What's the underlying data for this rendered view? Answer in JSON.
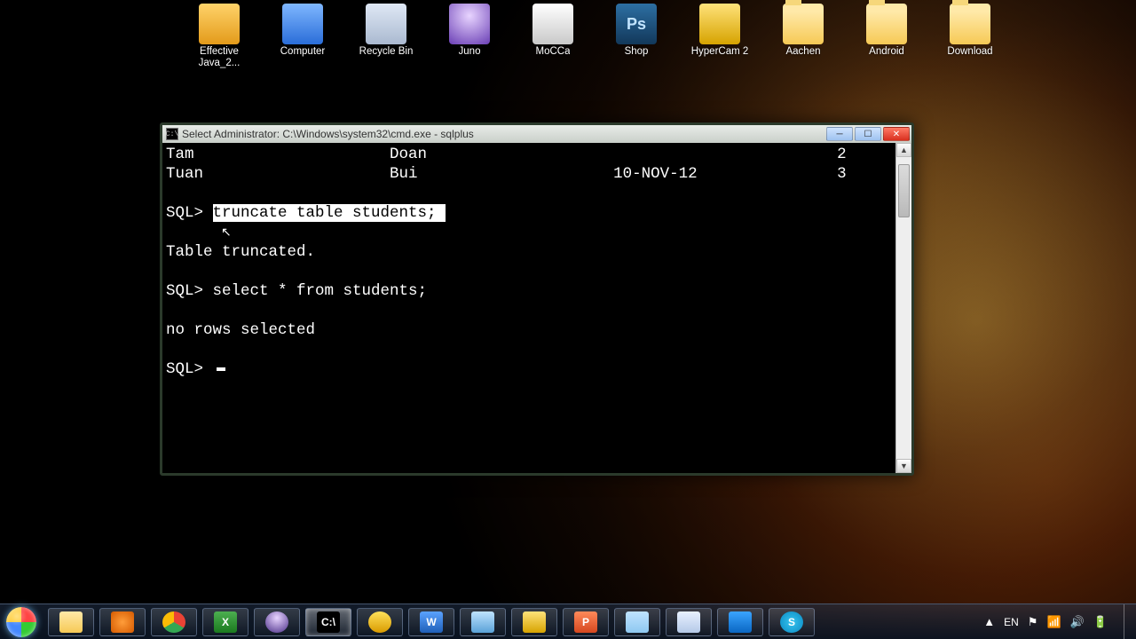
{
  "desktop_icons": [
    {
      "label": "Effective Java_2...",
      "kind": "pdf"
    },
    {
      "label": "Computer",
      "kind": "comp"
    },
    {
      "label": "Recycle Bin",
      "kind": "bin"
    },
    {
      "label": "Juno",
      "kind": "juno"
    },
    {
      "label": "MoCCa",
      "kind": "mocca"
    },
    {
      "label": "Shop",
      "kind": "ps",
      "text": "Ps"
    },
    {
      "label": "HyperCam 2",
      "kind": "hyper"
    },
    {
      "label": "Aachen",
      "kind": "folder"
    },
    {
      "label": "Android",
      "kind": "folder"
    },
    {
      "label": "Download",
      "kind": "folder"
    }
  ],
  "cmd": {
    "title": "Select Administrator: C:\\Windows\\system32\\cmd.exe - sqlplus",
    "sysicon": "C:\\",
    "rows": [
      {
        "c1": "Tam",
        "c2": "Doan",
        "c3": "",
        "c4": "2"
      },
      {
        "c1": "Tuan",
        "c2": "Bui",
        "c3": "10-NOV-12",
        "c4": "3"
      }
    ],
    "prompt": "SQL>",
    "highlighted_cmd": "truncate table students;",
    "response1": "Table truncated.",
    "cmd2": "select * from students;",
    "response2": "no rows selected"
  },
  "tray": {
    "lang": "EN",
    "chevron": "▲"
  },
  "task_items": [
    {
      "name": "explorer",
      "bg": "linear-gradient(#ffe9a8,#f6c955)"
    },
    {
      "name": "wmp",
      "bg": "radial-gradient(circle,#ff9d3a,#d55a00)"
    },
    {
      "name": "chrome",
      "bg": "conic-gradient(#ea4335 0 120deg,#34a853 120deg 240deg,#fbbc05 240deg 360deg)",
      "round": true
    },
    {
      "name": "excel",
      "bg": "linear-gradient(#4caf50,#1b7a1f)",
      "text": "X"
    },
    {
      "name": "eclipse",
      "bg": "radial-gradient(circle at 50% 30%,#e8d4ff,#4a2e88)",
      "round": true
    },
    {
      "name": "cmd",
      "bg": "#000",
      "text": "C:\\",
      "active": true
    },
    {
      "name": "jdownloader",
      "bg": "linear-gradient(#ffe15a,#d99b00)",
      "round": true
    },
    {
      "name": "word",
      "bg": "linear-gradient(#5aa2ff,#1f5fb8)",
      "text": "W"
    },
    {
      "name": "sqldev",
      "bg": "linear-gradient(#bfe3ff,#5aa2d8)"
    },
    {
      "name": "hypercam",
      "bg": "linear-gradient(#ffe27a,#d6a300)"
    },
    {
      "name": "powerpoint",
      "bg": "linear-gradient(#ff8a5a,#d5471f)",
      "text": "P"
    },
    {
      "name": "notepad",
      "bg": "linear-gradient(#bfe3ff,#8ec8f0)"
    },
    {
      "name": "paint",
      "bg": "linear-gradient(#e8f1ff,#b5c9e8)"
    },
    {
      "name": "teamviewer",
      "bg": "linear-gradient(#3aa4ff,#0a66c2)"
    },
    {
      "name": "skype",
      "bg": "radial-gradient(circle,#36c5f0,#0a88c2)",
      "text": "S",
      "round": true
    }
  ]
}
